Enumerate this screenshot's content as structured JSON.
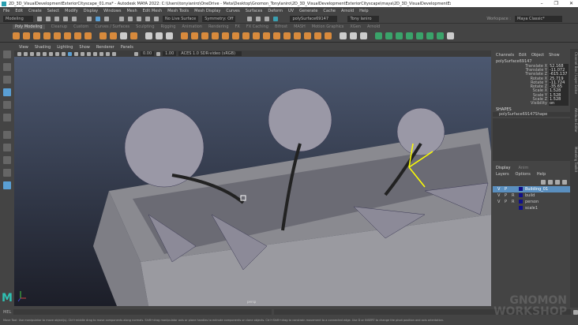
{
  "title": "2D_3D_VisualDevelopmentExteriorCityscape_01.ma* - Autodesk MAYA 2022: C:\\Users\\tonyianiro\\OneDrive - Meta\\Desktop\\Gnomon_TonyIaniro\\2D_3D_VisualDevelopmentExteriorCityscape\\maya\\2D_3D_VisualDevelopmentExteriorCityscape_01.ma --- polySurface69147",
  "window_controls": [
    "–",
    "❐",
    "✕"
  ],
  "menu": [
    "File",
    "Edit",
    "Create",
    "Select",
    "Modify",
    "Display",
    "Windows",
    "Mesh",
    "Edit Mesh",
    "Mesh Tools",
    "Mesh Display",
    "Curves",
    "Surfaces",
    "Deform",
    "UV",
    "Generate",
    "Cache",
    "Arnold",
    "Help"
  ],
  "status": {
    "menuset": "Modeling",
    "live_surface": "No Live Surface",
    "symmetry": "Symmetry: Off",
    "object_name": "polySurface69147",
    "user": "Tony Ianiro",
    "workspace_label": "Workspace :",
    "workspace": "Maya Classic*"
  },
  "shelf_tabs": [
    "Poly Modeling",
    "Cleanup",
    "Custom",
    "Curves / Surfaces",
    "Sculpting",
    "Rigging",
    "Animation",
    "Rendering",
    "FX",
    "FX Caching",
    "Bifrost",
    "MASH",
    "Motion Graphics",
    "XGen",
    "Arnold"
  ],
  "panel_menu": [
    "View",
    "Shading",
    "Lighting",
    "Show",
    "Renderer",
    "Panels"
  ],
  "panel_toolbar": {
    "exposure": "0.00",
    "gamma": "1.00",
    "color_space": "ACES 1.0 SDR-video (sRGB)"
  },
  "viewport": {
    "camera": "persp"
  },
  "channel_box": {
    "menu": [
      "Channels",
      "Edit",
      "Object",
      "Show"
    ],
    "object": "polySurface69147",
    "channels": [
      {
        "name": "Translate X",
        "value": "52.168"
      },
      {
        "name": "Translate Y",
        "value": "-11.072"
      },
      {
        "name": "Translate Z",
        "value": "-615.137"
      },
      {
        "name": "Rotate X",
        "value": "25.719"
      },
      {
        "name": "Rotate Y",
        "value": "-11.724"
      },
      {
        "name": "Rotate Z",
        "value": "-35.65"
      },
      {
        "name": "Scale X",
        "value": "1.528"
      },
      {
        "name": "Scale Y",
        "value": "1.528"
      },
      {
        "name": "Scale Z",
        "value": "1.528"
      },
      {
        "name": "Visibility",
        "value": "on"
      }
    ],
    "shapes_label": "SHAPES",
    "shape": "polySurface69147Shape"
  },
  "layer_editor": {
    "tabs": [
      "Display",
      "Anim"
    ],
    "menu": [
      "Layers",
      "Options",
      "Help"
    ],
    "layers": [
      {
        "v": "V",
        "p": "P",
        "r": "",
        "name": "Building_01"
      },
      {
        "v": "V",
        "p": "P",
        "r": "R",
        "name": "build"
      },
      {
        "v": "V",
        "p": "P",
        "r": "R",
        "name": "person"
      },
      {
        "v": "",
        "p": "",
        "r": "",
        "name": "scale1"
      }
    ]
  },
  "side_tabs": [
    "Channel Box / Layer Editor",
    "Attribute Editor",
    "Modeling Toolkit"
  ],
  "command_line": {
    "label": "MEL"
  },
  "help_line": "Move Tool: Use manipulator to move object(s). Ctrl+middle drag to move components along normals. Shift+drag manipulator axis or plane handles to extrude components or clone objects. Ctrl+Shift+drag to constrain movement to a connected edge. Use D or INSERT to change the pivot position and axis orientation.",
  "watermark": "GNOMON WORKSHOP"
}
